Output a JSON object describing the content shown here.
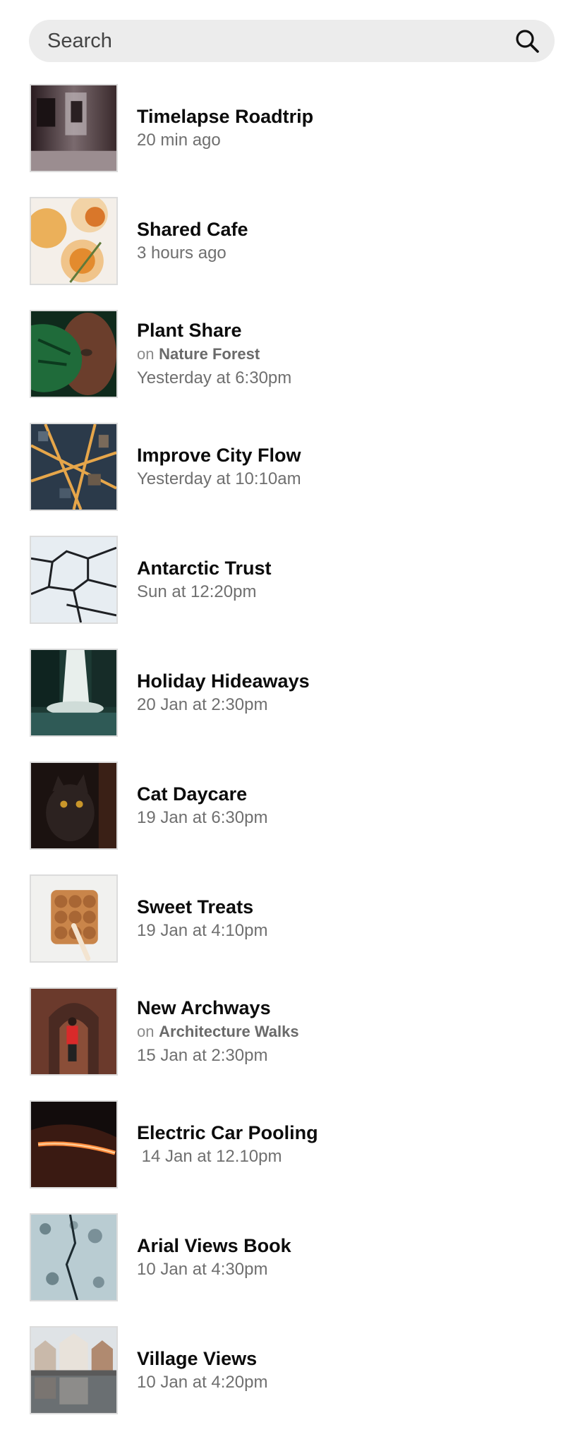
{
  "search": {
    "placeholder": "Search",
    "icon": "search-icon"
  },
  "items": [
    {
      "title": "Timelapse Roadtrip",
      "time": "20 min ago",
      "thumb": "subway-train-photo"
    },
    {
      "title": "Shared Cafe",
      "time": "3 hours ago",
      "thumb": "cocktail-drinks-photo"
    },
    {
      "title": "Plant Share",
      "group_prefix": "on",
      "group": "Nature Forest",
      "time": "Yesterday at 6:30pm",
      "thumb": "monstera-leaf-portrait-photo"
    },
    {
      "title": "Improve City Flow",
      "time": "Yesterday at 10:10am",
      "thumb": "city-night-aerial-photo"
    },
    {
      "title": "Antarctic Trust",
      "time": "Sun at 12:20pm",
      "thumb": "cracked-ice-photo"
    },
    {
      "title": "Holiday Hideaways",
      "time": "20 Jan at 2:30pm",
      "thumb": "waterfall-photo"
    },
    {
      "title": "Cat Daycare",
      "time": "19 Jan at 6:30pm",
      "thumb": "black-cat-photo"
    },
    {
      "title": "Sweet Treats",
      "time": "19 Jan at 4:10pm",
      "thumb": "cinnamon-rolls-photo"
    },
    {
      "title": "New Archways",
      "group_prefix": "on",
      "group": "Architecture Walks",
      "time": "15 Jan at 2:30pm",
      "thumb": "brick-archway-person-photo"
    },
    {
      "title": "Electric Car Pooling",
      "time": " 14 Jan at 12.10pm",
      "thumb": "car-headlight-photo"
    },
    {
      "title": "Arial Views Book",
      "time": "10 Jan at 4:30pm",
      "thumb": "snowy-forest-aerial-photo"
    },
    {
      "title": "Village Views",
      "time": "10 Jan at 4:20pm",
      "thumb": "canal-village-photo"
    }
  ],
  "colors": {
    "search_bg": "#ececec",
    "title": "#0c0c0c",
    "meta": "#6f6f6f",
    "thumb_border": "#dcdcdc"
  }
}
